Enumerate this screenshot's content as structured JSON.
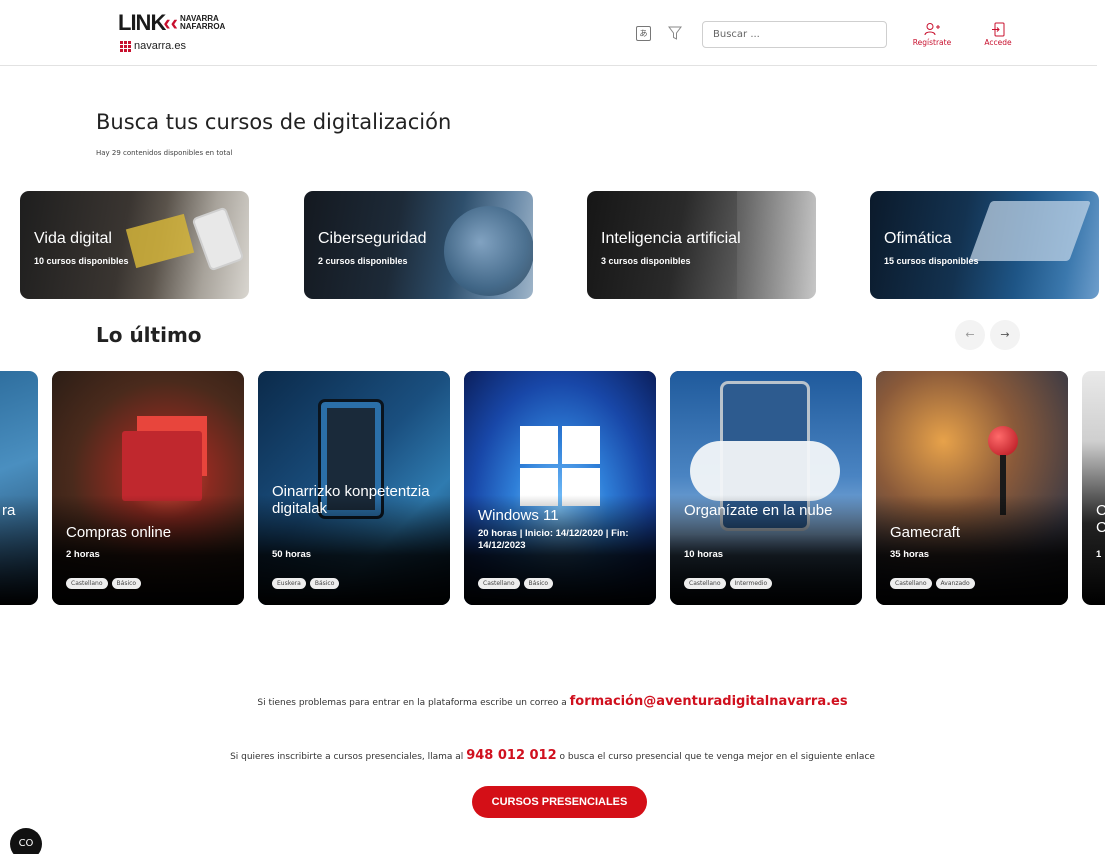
{
  "header": {
    "logo_main": "LINK",
    "logo_sub_1": "NAVARRA",
    "logo_sub_2": "NAFARROA",
    "logo_site": "navarra.es",
    "search_placeholder": "Buscar ...",
    "register_label": "Regístrate",
    "login_label": "Accede"
  },
  "hero": {
    "title": "Busca tus cursos de digitalización",
    "subtitle": "Hay 29 contenidos disponibles en total"
  },
  "categories": [
    {
      "name": "Vida digital",
      "count": "10 cursos disponibles"
    },
    {
      "name": "Ciberseguridad",
      "count": "2 cursos disponibles"
    },
    {
      "name": "Inteligencia artificial",
      "count": "3 cursos disponibles"
    },
    {
      "name": "Ofimática",
      "count": "15 cursos disponibles"
    }
  ],
  "latest": {
    "title": "Lo último",
    "prev_label": "←",
    "next_label": "→",
    "edge_left_text": "ra",
    "edge_right_text_1": "C",
    "edge_right_text_2": "C",
    "edge_right_meta": "1",
    "courses": [
      {
        "title": "Compras online",
        "meta": "2 horas",
        "tags": [
          "Castellano",
          "Básico"
        ]
      },
      {
        "title": "Oinarrizko konpetentzia digitalak",
        "meta": "50 horas",
        "tags": [
          "Euskera",
          "Básico"
        ]
      },
      {
        "title": "Windows 11",
        "meta": "20 horas | Inicio: 14/12/2020 | Fin: 14/12/2023",
        "tags": [
          "Castellano",
          "Básico"
        ]
      },
      {
        "title": "Organízate en la nube",
        "meta": "10 horas",
        "tags": [
          "Castellano",
          "Intermedio"
        ]
      },
      {
        "title": "Gamecraft",
        "meta": "35 horas",
        "tags": [
          "Castellano",
          "Avanzado"
        ]
      }
    ]
  },
  "footer": {
    "line1_text": "Si tienes problemas para entrar en la plataforma escribe un correo a",
    "line1_email": "formación@aventuradigitalnavarra.es",
    "line2_before": "Si quieres inscribirte a cursos presenciales, llama al",
    "line2_phone": "948 012 012",
    "line2_after": "o busca el curso presencial que te venga mejor en el siguiente enlace",
    "cta_label": "CURSOS PRESENCIALES",
    "badge_label": "CO"
  },
  "colors": {
    "accent": "#d40f17",
    "text": "#222222"
  }
}
